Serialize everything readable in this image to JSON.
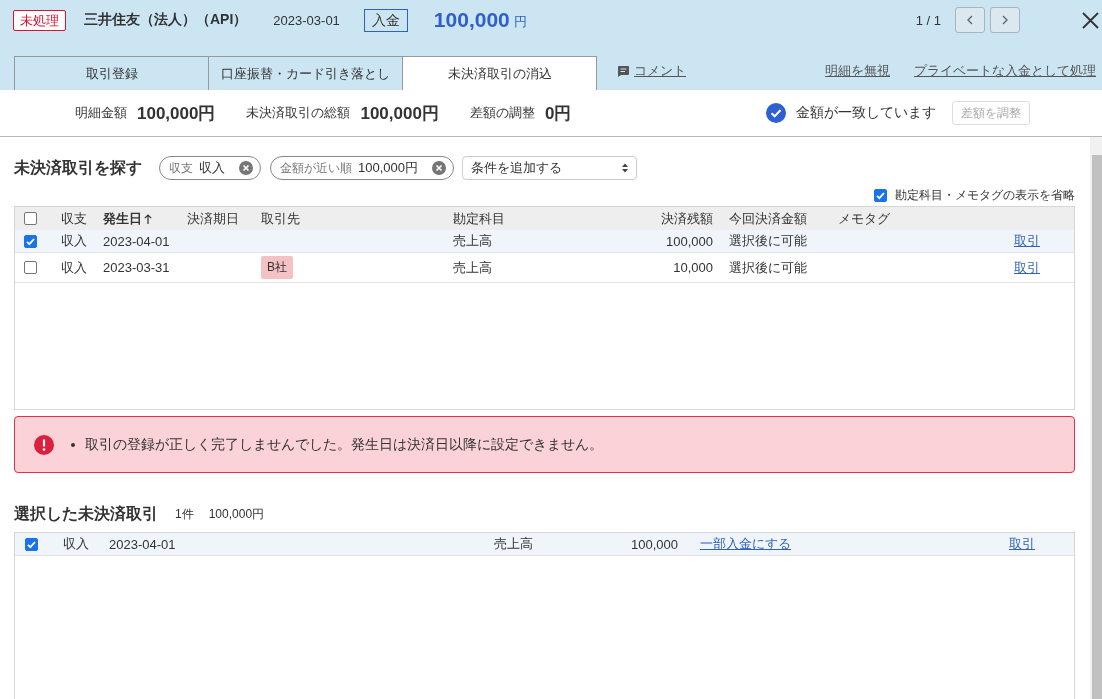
{
  "header": {
    "status": "未処理",
    "account": "三井住友（法人）（API）",
    "date": "2023-03-01",
    "direction": "入金",
    "amount": "100,000",
    "currency": "円",
    "pager": "1 / 1"
  },
  "tabs": [
    {
      "label": "取引登録",
      "selected": false
    },
    {
      "label": "口座振替・カード引き落とし",
      "selected": false
    },
    {
      "label": "未決済取引の消込",
      "selected": true
    }
  ],
  "comment_link": "コメント",
  "action_links": [
    "明細を無視",
    "プライベートな入金として処理"
  ],
  "summary": {
    "items": [
      {
        "label": "明細金額",
        "value": "100,000円"
      },
      {
        "label": "未決済取引の総額",
        "value": "100,000円"
      },
      {
        "label": "差額の調整",
        "value": "0円"
      }
    ],
    "matched": true,
    "match_text": "金額が一致しています",
    "adjust_button": {
      "label": "差額を調整",
      "disabled": true
    }
  },
  "search": {
    "title": "未決済取引を探す",
    "filters": [
      {
        "label": "収支",
        "value": "収入"
      },
      {
        "label": "金額が近い順",
        "value": "100,000円"
      }
    ],
    "add_condition": "条件を追加する",
    "omit_option": {
      "label": "勘定科目・メモタグの表示を省略",
      "checked": true
    }
  },
  "table": {
    "all_checked": false,
    "columns": [
      {
        "label": "収支",
        "sorted": false
      },
      {
        "label": "発生日",
        "sorted": true
      },
      {
        "label": "決済期日",
        "sorted": false
      },
      {
        "label": "取引先",
        "sorted": false
      },
      {
        "label": "勘定科目",
        "sorted": false
      },
      {
        "label": "決済残額",
        "sorted": false
      },
      {
        "label": "今回決済金額",
        "sorted": false
      },
      {
        "label": "メモタグ",
        "sorted": false
      }
    ],
    "rows": [
      {
        "checked": true,
        "type": "収入",
        "date": "2023-04-01",
        "account": "売上高",
        "balance": "100,000",
        "payment": "選択後に可能",
        "link": "取引"
      },
      {
        "checked": false,
        "type": "収入",
        "date": "2023-03-31",
        "partner": "B社",
        "account": "売上高",
        "balance": "10,000",
        "payment": "選択後に可能",
        "link": "取引"
      }
    ]
  },
  "error": {
    "messages": [
      "取引の登録が正しく完了しませんでした。発生日は決済日以降に設定できません。"
    ]
  },
  "selected": {
    "title": "選択した未決済取引",
    "count": "1件",
    "total": "100,000円",
    "rows": [
      {
        "checked": true,
        "type": "収入",
        "date": "2023-04-01",
        "account": "売上高",
        "balance": "100,000",
        "partial_link": "一部入金にする",
        "link": "取引"
      }
    ]
  }
}
